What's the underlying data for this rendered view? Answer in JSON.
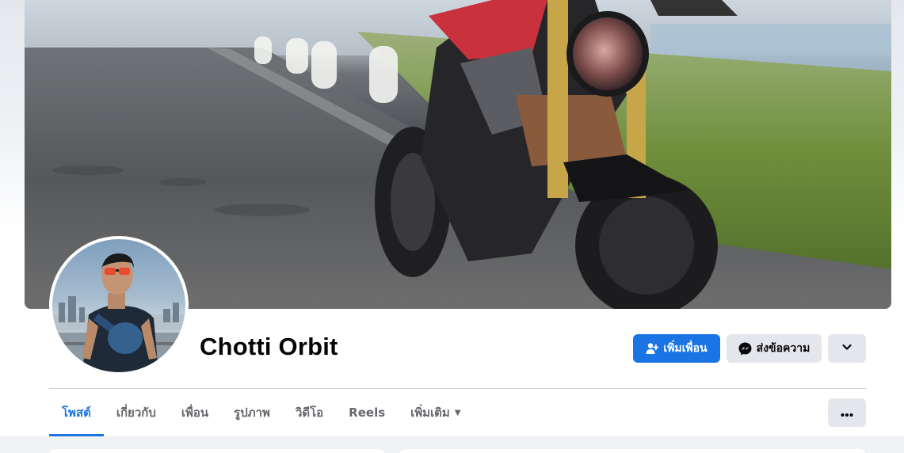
{
  "profile": {
    "name": "Chotti Orbit"
  },
  "actions": {
    "add_friend_label": "เพิ่มเพื่อน",
    "message_label": "ส่งข้อความ"
  },
  "tabs": [
    {
      "label": "โพสต์",
      "active": true
    },
    {
      "label": "เกี่ยวกับ",
      "active": false
    },
    {
      "label": "เพื่อน",
      "active": false
    },
    {
      "label": "รูปภาพ",
      "active": false
    },
    {
      "label": "วิดีโอ",
      "active": false
    },
    {
      "label": "Reels",
      "active": false
    },
    {
      "label": "เพิ่มเติม",
      "active": false
    }
  ],
  "icons": {
    "add_friend": "person-plus-icon",
    "message": "messenger-icon",
    "expand": "chevron-down-icon",
    "more_tab": "caret-down-icon",
    "options": "ellipsis-icon"
  },
  "colors": {
    "accent": "#1b74e4",
    "button_gray": "#e4e6eb",
    "text_primary": "#050505",
    "text_secondary": "#65676b"
  }
}
